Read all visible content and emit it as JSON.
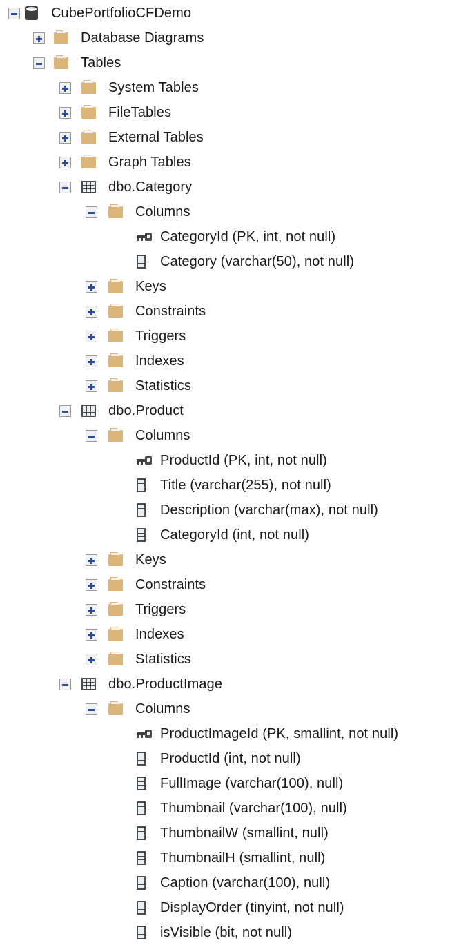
{
  "app": {
    "pane": "Object Explorer",
    "product": "SQL Server Management Studio"
  },
  "colors": {
    "folder": "#dbb579",
    "icon_dark": "#4a4a4a",
    "expander_glyph": "#2c4b9b",
    "text": "#1a1a1a",
    "background": "#ffffff"
  },
  "tree": {
    "nodes": [
      {
        "label": "CubePortfolioCFDemo",
        "depth": 0,
        "icon": "database-icon",
        "expander": "minus",
        "name": "tree-node-database"
      },
      {
        "label": "Database Diagrams",
        "depth": 1,
        "icon": "folder-icon",
        "expander": "plus",
        "name": "tree-node-database-diagrams"
      },
      {
        "label": "Tables",
        "depth": 1,
        "icon": "folder-icon",
        "expander": "minus",
        "name": "tree-node-tables"
      },
      {
        "label": "System Tables",
        "depth": 2,
        "icon": "folder-icon",
        "expander": "plus",
        "name": "tree-node-system-tables"
      },
      {
        "label": "FileTables",
        "depth": 2,
        "icon": "folder-icon",
        "expander": "plus",
        "name": "tree-node-filetables"
      },
      {
        "label": "External Tables",
        "depth": 2,
        "icon": "folder-icon",
        "expander": "plus",
        "name": "tree-node-external-tables"
      },
      {
        "label": "Graph Tables",
        "depth": 2,
        "icon": "folder-icon",
        "expander": "plus",
        "name": "tree-node-graph-tables"
      },
      {
        "label": "dbo.Category",
        "depth": 2,
        "icon": "table-icon",
        "expander": "minus",
        "name": "tree-node-table-dbo-category"
      },
      {
        "label": "Columns",
        "depth": 3,
        "icon": "folder-icon",
        "expander": "minus",
        "name": "tree-node-category-columns"
      },
      {
        "label": "CategoryId (PK, int, not null)",
        "depth": 4,
        "icon": "key-icon",
        "expander": "none",
        "name": "tree-node-column-categoryid"
      },
      {
        "label": "Category (varchar(50), not null)",
        "depth": 4,
        "icon": "column-icon",
        "expander": "none",
        "name": "tree-node-column-category"
      },
      {
        "label": "Keys",
        "depth": 3,
        "icon": "folder-icon",
        "expander": "plus",
        "name": "tree-node-category-keys"
      },
      {
        "label": "Constraints",
        "depth": 3,
        "icon": "folder-icon",
        "expander": "plus",
        "name": "tree-node-category-constraints"
      },
      {
        "label": "Triggers",
        "depth": 3,
        "icon": "folder-icon",
        "expander": "plus",
        "name": "tree-node-category-triggers"
      },
      {
        "label": "Indexes",
        "depth": 3,
        "icon": "folder-icon",
        "expander": "plus",
        "name": "tree-node-category-indexes"
      },
      {
        "label": "Statistics",
        "depth": 3,
        "icon": "folder-icon",
        "expander": "plus",
        "name": "tree-node-category-statistics"
      },
      {
        "label": "dbo.Product",
        "depth": 2,
        "icon": "table-icon",
        "expander": "minus",
        "name": "tree-node-table-dbo-product"
      },
      {
        "label": "Columns",
        "depth": 3,
        "icon": "folder-icon",
        "expander": "minus",
        "name": "tree-node-product-columns"
      },
      {
        "label": "ProductId (PK, int, not null)",
        "depth": 4,
        "icon": "key-icon",
        "expander": "none",
        "name": "tree-node-column-productid"
      },
      {
        "label": "Title (varchar(255), not null)",
        "depth": 4,
        "icon": "column-icon",
        "expander": "none",
        "name": "tree-node-column-title"
      },
      {
        "label": "Description (varchar(max), not null)",
        "depth": 4,
        "icon": "column-icon",
        "expander": "none",
        "name": "tree-node-column-description"
      },
      {
        "label": "CategoryId (int, not null)",
        "depth": 4,
        "icon": "column-icon",
        "expander": "none",
        "name": "tree-node-column-product-categoryid"
      },
      {
        "label": "Keys",
        "depth": 3,
        "icon": "folder-icon",
        "expander": "plus",
        "name": "tree-node-product-keys"
      },
      {
        "label": "Constraints",
        "depth": 3,
        "icon": "folder-icon",
        "expander": "plus",
        "name": "tree-node-product-constraints"
      },
      {
        "label": "Triggers",
        "depth": 3,
        "icon": "folder-icon",
        "expander": "plus",
        "name": "tree-node-product-triggers"
      },
      {
        "label": "Indexes",
        "depth": 3,
        "icon": "folder-icon",
        "expander": "plus",
        "name": "tree-node-product-indexes"
      },
      {
        "label": "Statistics",
        "depth": 3,
        "icon": "folder-icon",
        "expander": "plus",
        "name": "tree-node-product-statistics"
      },
      {
        "label": "dbo.ProductImage",
        "depth": 2,
        "icon": "table-icon",
        "expander": "minus",
        "name": "tree-node-table-dbo-productimage"
      },
      {
        "label": "Columns",
        "depth": 3,
        "icon": "folder-icon",
        "expander": "minus",
        "name": "tree-node-productimage-columns"
      },
      {
        "label": "ProductImageId (PK, smallint, not null)",
        "depth": 4,
        "icon": "key-icon",
        "expander": "none",
        "name": "tree-node-column-productimageid"
      },
      {
        "label": "ProductId (int, not null)",
        "depth": 4,
        "icon": "column-icon",
        "expander": "none",
        "name": "tree-node-column-productimage-productid"
      },
      {
        "label": "FullImage (varchar(100), null)",
        "depth": 4,
        "icon": "column-icon",
        "expander": "none",
        "name": "tree-node-column-fullimage"
      },
      {
        "label": "Thumbnail (varchar(100), null)",
        "depth": 4,
        "icon": "column-icon",
        "expander": "none",
        "name": "tree-node-column-thumbnail"
      },
      {
        "label": "ThumbnailW (smallint, null)",
        "depth": 4,
        "icon": "column-icon",
        "expander": "none",
        "name": "tree-node-column-thumbnailw"
      },
      {
        "label": "ThumbnailH (smallint, null)",
        "depth": 4,
        "icon": "column-icon",
        "expander": "none",
        "name": "tree-node-column-thumbnailh"
      },
      {
        "label": "Caption (varchar(100), null)",
        "depth": 4,
        "icon": "column-icon",
        "expander": "none",
        "name": "tree-node-column-caption"
      },
      {
        "label": "DisplayOrder (tinyint, not null)",
        "depth": 4,
        "icon": "column-icon",
        "expander": "none",
        "name": "tree-node-column-displayorder"
      },
      {
        "label": "isVisible (bit, not null)",
        "depth": 4,
        "icon": "column-icon",
        "expander": "none",
        "name": "tree-node-column-isvisible"
      }
    ]
  }
}
